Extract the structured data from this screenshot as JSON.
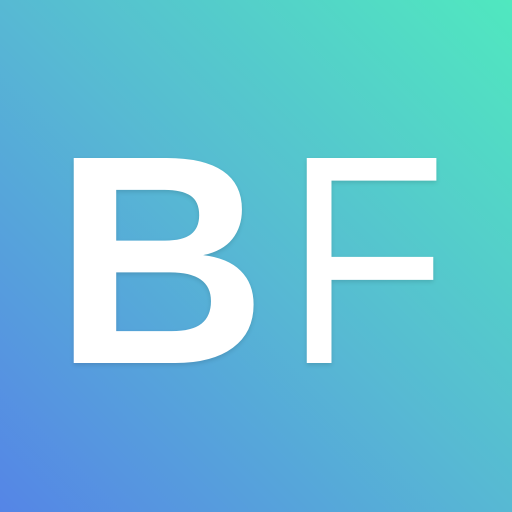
{
  "icon": {
    "letters": {
      "first": "B",
      "second": "F"
    },
    "colors": {
      "gradient_start": "#5585e6",
      "gradient_mid": "#57b9d3",
      "gradient_end": "#50e8bf",
      "text": "#ffffff"
    }
  }
}
